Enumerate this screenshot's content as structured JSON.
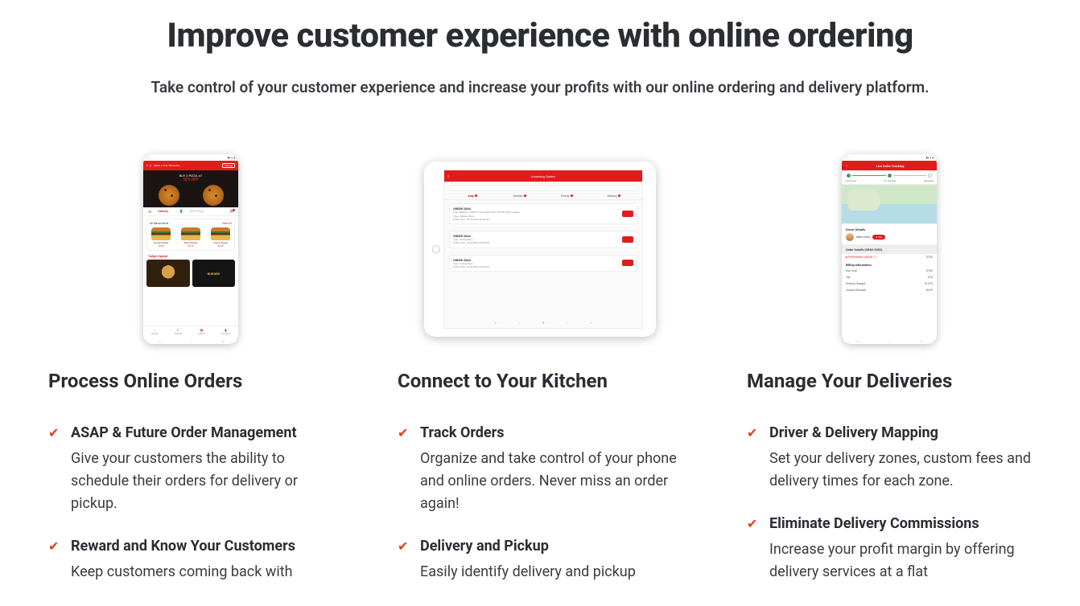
{
  "headline": "Improve customer experience with online ordering",
  "subhead": "Take control of your customer experience and increase your profits with our online ordering and delivery platform.",
  "columns": [
    {
      "title": "Process Online Orders",
      "features": [
        {
          "title": "ASAP & Future Order Management",
          "desc": "Give your customers the ability to schedule their orders for delivery or pickup."
        },
        {
          "title": "Reward and Know Your Customers",
          "desc": "Keep customers coming back with"
        }
      ]
    },
    {
      "title": "Connect to Your Kitchen",
      "features": [
        {
          "title": "Track Orders",
          "desc": "Organize and take control of your phone and online orders. Never miss an order again!"
        },
        {
          "title": "Delivery and Pickup",
          "desc": "Easily identify delivery and pickup"
        }
      ]
    },
    {
      "title": "Manage Your Deliveries",
      "features": [
        {
          "title": "Driver & Delivery Mapping",
          "desc": "Set your delivery zones, custom fees and delivery times for each zone."
        },
        {
          "title": "Eliminate Delivery Commissions",
          "desc": "Increase your profit margin by offering delivery services at a flat"
        }
      ]
    }
  ],
  "phone1": {
    "address": "10650 113 St. Edmonton",
    "change": "Change",
    "promo_line1": "BUY 2 PIZZA AT",
    "promo_line2": "50% OFF",
    "tab_delivery": "Delivery",
    "tab_pickup": "Self Pickup",
    "menu_head": "All Menu Items",
    "view_all": "View All",
    "items": [
      {
        "name": "Chicken Burger",
        "price": "$4.50"
      },
      {
        "name": "Bacon Burger",
        "price": "$6.25"
      },
      {
        "name": "Classic Burger",
        "price": "$4.75"
      }
    ],
    "specials_head": "Today's Special",
    "sp2_text": "BURGER",
    "nav": [
      "Home",
      "Tracker",
      "Offers",
      "Account"
    ]
  },
  "tablet": {
    "header": "Incoming Orders",
    "tabs": [
      "Asap",
      "Kitchen",
      "Pickup",
      "Delivery"
    ],
    "orders": [
      {
        "id": "ORDER 2844",
        "lines": [
          "Drop Address : 10650 113 St, Edmonton, AB T5H 3H6, Canada",
          "Type : Delivery Now",
          "Order Time : 5/10/2022 09:30 AM"
        ]
      },
      {
        "id": "ORDER 2844",
        "lines": [
          "Type : Pickup Now",
          "Order Time : 5/10/2022 09:30 AM"
        ]
      },
      {
        "id": "ORDER 2844",
        "lines": [
          "Type : Pickup Now",
          "Order Time : 5/10/2022 09:30 AM"
        ]
      }
    ]
  },
  "phone3": {
    "title": "Live Order Tracking",
    "step1": "Confirmed",
    "step2": "On The Way",
    "step3": "Delivered",
    "driver_head": "Driver Details",
    "driver_name": "Mike Driver",
    "call": "Call",
    "order_head": "Order Details (ORD# 2692)",
    "item_name": "PEPPERONI CHEESE x 1",
    "item_price": "$7.00",
    "bill_head": "Billing Information",
    "rows": [
      {
        "k": "Sub Total",
        "v": "$7.00"
      },
      {
        "k": "Tax",
        "v": "$.35"
      },
      {
        "k": "Delivery Charges",
        "v": "$13.99"
      },
      {
        "k": "Coupon Discount",
        "v": "$0.39"
      }
    ]
  }
}
